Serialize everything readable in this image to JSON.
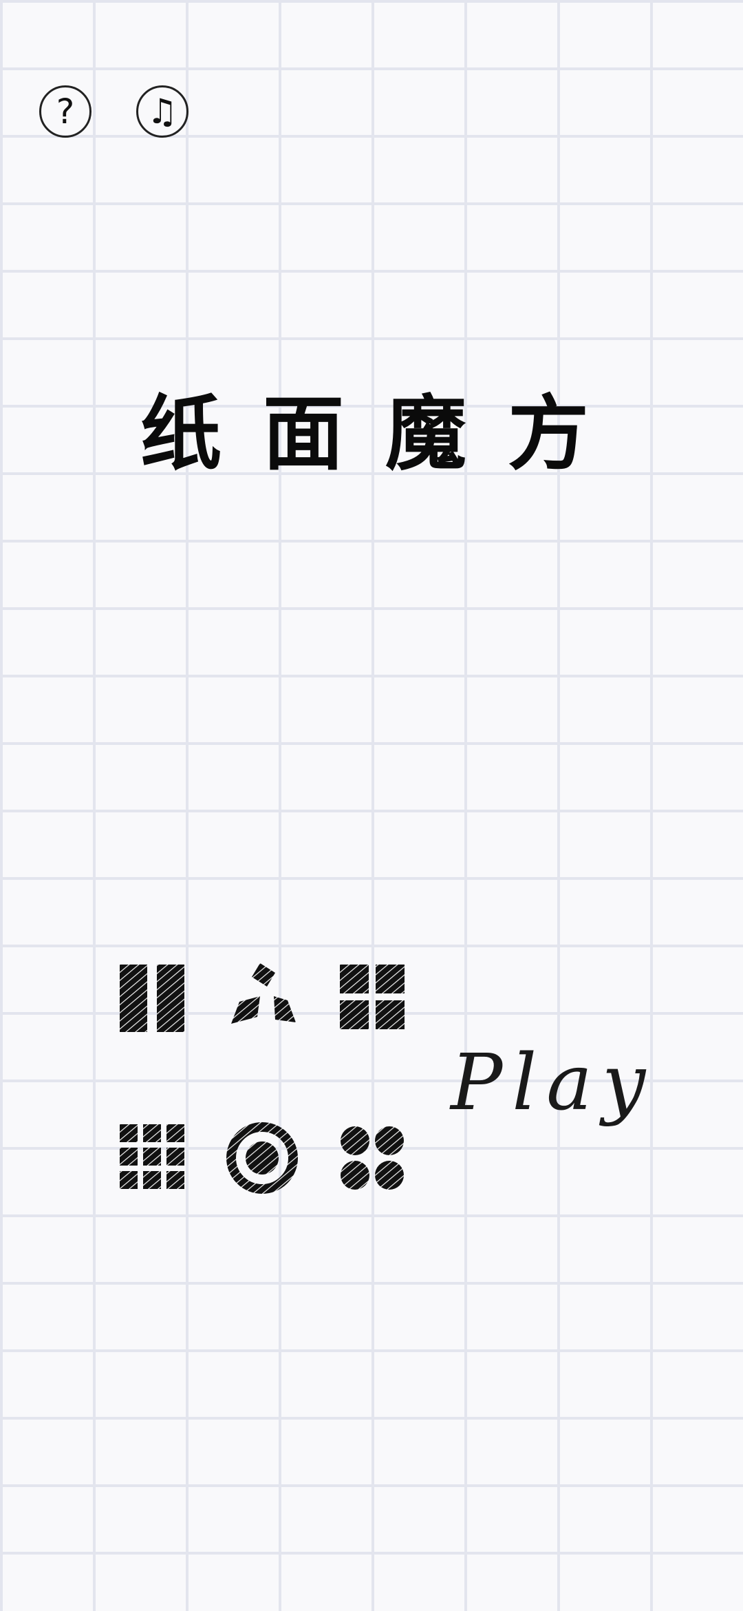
{
  "top_buttons": {
    "help": {
      "icon": "help-icon",
      "glyph": "?"
    },
    "music": {
      "icon": "music-note-icon",
      "glyph": "♫"
    }
  },
  "title": "纸面魔方",
  "modes": [
    {
      "icon": "two-bars-icon"
    },
    {
      "icon": "triangle-pieces-icon"
    },
    {
      "icon": "four-squares-icon"
    },
    {
      "icon": "grid-squares-icon"
    },
    {
      "icon": "ring-icon"
    },
    {
      "icon": "four-dots-icon"
    }
  ],
  "play_label": "Play",
  "colors": {
    "ink": "#111111",
    "paper": "#f9f9fb",
    "grid_line": "#e3e5ee"
  }
}
